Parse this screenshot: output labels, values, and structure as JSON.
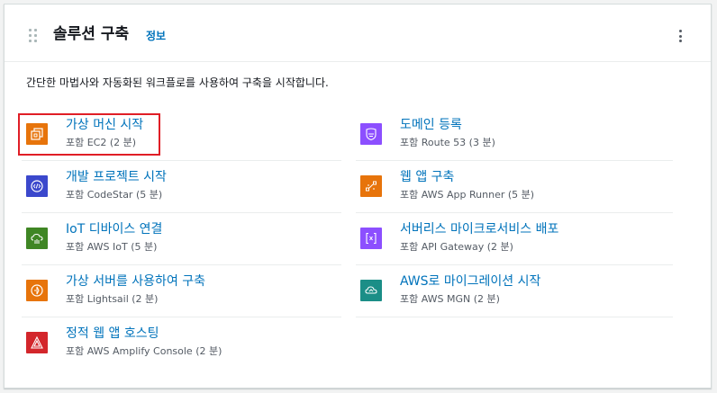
{
  "header": {
    "title": "솔루션 구축",
    "info_link": "정보"
  },
  "description": "간단한 마법사와 자동화된 워크플로를 사용하여 구축을 시작합니다.",
  "colors": {
    "orange": "#e7740b",
    "blue": "#3b48cc",
    "green": "#3f8624",
    "purple": "#8c4fff",
    "red": "#d3262b",
    "teal": "#1b8e87",
    "link": "#0073bb",
    "highlight": "#e01e26"
  },
  "left_items": [
    {
      "name": "가상 머신 시작",
      "sub": "포함 EC2 (2 분)",
      "icon": "ec2-icon"
    },
    {
      "name": "개발 프로젝트 시작",
      "sub": "포함 CodeStar (5 분)",
      "icon": "codestar-icon"
    },
    {
      "name": "IoT 디바이스 연결",
      "sub": "포함 AWS IoT (5 분)",
      "icon": "iot-icon"
    },
    {
      "name": "가상 서버를 사용하여 구축",
      "sub": "포함 Lightsail (2 분)",
      "icon": "lightsail-icon"
    },
    {
      "name": "정적 웹 앱 호스팅",
      "sub": "포함 AWS Amplify Console (2 분)",
      "icon": "amplify-icon"
    }
  ],
  "right_items": [
    {
      "name": "도메인 등록",
      "sub": "포함 Route 53 (3 분)",
      "icon": "route53-icon"
    },
    {
      "name": "웹 앱 구축",
      "sub": "포함 AWS App Runner (5 분)",
      "icon": "app-runner-icon"
    },
    {
      "name": "서버리스 마이크로서비스 배포",
      "sub": "포함 API Gateway (2 분)",
      "icon": "api-gateway-icon"
    },
    {
      "name": "AWS로 마이그레이션 시작",
      "sub": "포함 AWS MGN (2 분)",
      "icon": "mgn-icon"
    }
  ]
}
